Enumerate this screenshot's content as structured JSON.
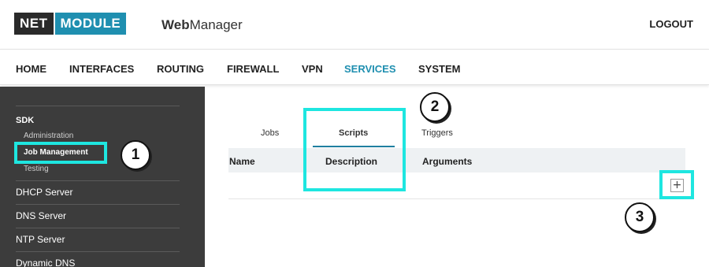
{
  "header": {
    "logo_left": "NET",
    "logo_right": "MODULE",
    "app_bold": "Web",
    "app_rest": "Manager",
    "logout": "LOGOUT"
  },
  "nav": {
    "items": [
      "HOME",
      "INTERFACES",
      "ROUTING",
      "FIREWALL",
      "VPN",
      "SERVICES",
      "SYSTEM"
    ],
    "active": "SERVICES"
  },
  "sidebar": {
    "section": "SDK",
    "subitems": [
      "Administration",
      "Job Management",
      "Testing"
    ],
    "active_sub": "Job Management",
    "items": [
      "DHCP Server",
      "DNS Server",
      "NTP Server",
      "Dynamic DNS"
    ]
  },
  "tabs": {
    "items": [
      "Jobs",
      "Scripts",
      "Triggers"
    ],
    "active": "Scripts"
  },
  "table": {
    "columns": [
      "Name",
      "Description",
      "Arguments"
    ]
  },
  "add_button": "+",
  "annotations": {
    "badges": [
      "1",
      "2",
      "3"
    ],
    "highlight_color": "#1ee6e0"
  },
  "colors": {
    "accent": "#1f8fb0",
    "sidebar_bg": "#3c3c3c"
  }
}
